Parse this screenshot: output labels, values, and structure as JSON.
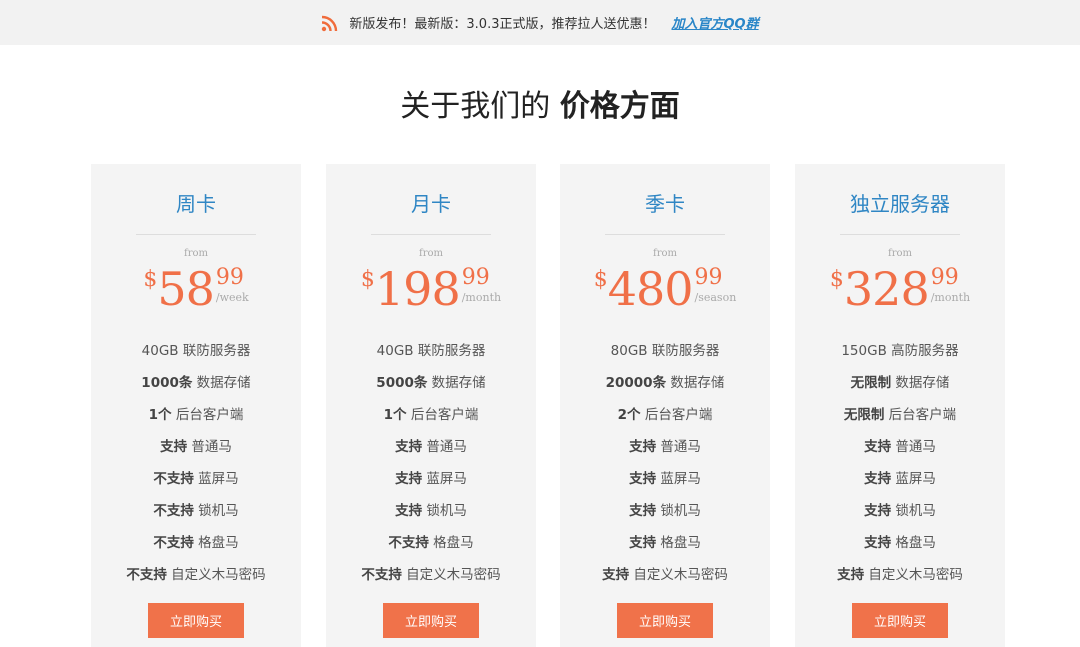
{
  "notice": {
    "text": "新版发布！最新版：3.0.3正式版，推荐拉人送优惠！",
    "link": "加入官方QQ群",
    "accent": "#f06c3c"
  },
  "heading": {
    "normal": "关于我们的 ",
    "bold": "价格方面"
  },
  "colors": {
    "plan_name": "#2f86c4",
    "price": "#f07048",
    "button": "#f0724a"
  },
  "plans": [
    {
      "name": "周卡",
      "from": "from",
      "currency": "$",
      "amount": "58",
      "cents": "99",
      "period": "/week",
      "features": [
        {
          "strong": "",
          "text": "40GB 联防服务器"
        },
        {
          "strong": "1000条",
          "text": " 数据存储"
        },
        {
          "strong": "1个",
          "text": " 后台客户端"
        },
        {
          "strong": "支持",
          "text": " 普通马"
        },
        {
          "strong": "不支持",
          "text": " 蓝屏马"
        },
        {
          "strong": "不支持",
          "text": " 锁机马"
        },
        {
          "strong": "不支持",
          "text": " 格盘马"
        },
        {
          "strong": "不支持",
          "text": " 自定义木马密码"
        }
      ],
      "button": "立即购买"
    },
    {
      "name": "月卡",
      "from": "from",
      "currency": "$",
      "amount": "198",
      "cents": "99",
      "period": "/month",
      "features": [
        {
          "strong": "",
          "text": "40GB 联防服务器"
        },
        {
          "strong": "5000条",
          "text": " 数据存储"
        },
        {
          "strong": "1个",
          "text": " 后台客户端"
        },
        {
          "strong": "支持",
          "text": " 普通马"
        },
        {
          "strong": "支持",
          "text": " 蓝屏马"
        },
        {
          "strong": "支持",
          "text": " 锁机马"
        },
        {
          "strong": "不支持",
          "text": " 格盘马"
        },
        {
          "strong": "不支持",
          "text": " 自定义木马密码"
        }
      ],
      "button": "立即购买"
    },
    {
      "name": "季卡",
      "from": "from",
      "currency": "$",
      "amount": "480",
      "cents": "99",
      "period": "/season",
      "features": [
        {
          "strong": "",
          "text": "80GB 联防服务器"
        },
        {
          "strong": "20000条",
          "text": " 数据存储"
        },
        {
          "strong": "2个",
          "text": " 后台客户端"
        },
        {
          "strong": "支持",
          "text": " 普通马"
        },
        {
          "strong": "支持",
          "text": " 蓝屏马"
        },
        {
          "strong": "支持",
          "text": " 锁机马"
        },
        {
          "strong": "支持",
          "text": " 格盘马"
        },
        {
          "strong": "支持",
          "text": " 自定义木马密码"
        }
      ],
      "button": "立即购买"
    },
    {
      "name": "独立服务器",
      "from": "from",
      "currency": "$",
      "amount": "328",
      "cents": "99",
      "period": "/month",
      "features": [
        {
          "strong": "",
          "text": "150GB 高防服务器"
        },
        {
          "strong": "无限制",
          "text": " 数据存储"
        },
        {
          "strong": "无限制",
          "text": " 后台客户端"
        },
        {
          "strong": "支持",
          "text": " 普通马"
        },
        {
          "strong": "支持",
          "text": " 蓝屏马"
        },
        {
          "strong": "支持",
          "text": " 锁机马"
        },
        {
          "strong": "支持",
          "text": " 格盘马"
        },
        {
          "strong": "支持",
          "text": " 自定义木马密码"
        }
      ],
      "button": "立即购买"
    }
  ]
}
